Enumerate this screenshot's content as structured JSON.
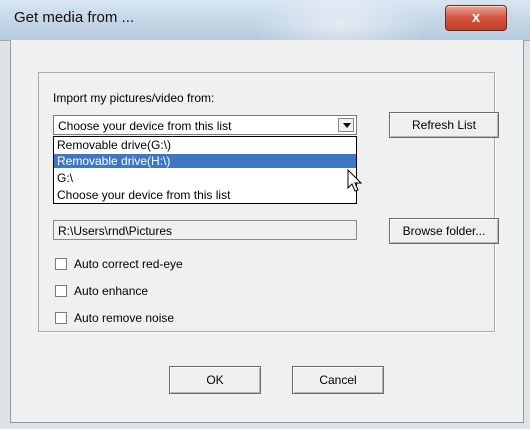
{
  "window": {
    "title": "Get media from ...",
    "close_glyph": "x"
  },
  "group": {
    "label": "Import my pictures/video from:"
  },
  "device_combo": {
    "selected": "Choose your device from this list",
    "options": [
      "Removable drive(G:\\)",
      "Removable drive(H:\\)",
      "G:\\",
      "Choose your device from this list"
    ],
    "highlighted_index": 1
  },
  "buttons": {
    "refresh": "Refresh List",
    "browse": "Browse folder...",
    "ok": "OK",
    "cancel": "Cancel"
  },
  "folder_path": {
    "value": "R:\\Users\\rnd\\Pictures"
  },
  "options": {
    "red_eye": "Auto correct red-eye",
    "enhance": "Auto enhance",
    "noise": "Auto remove noise"
  },
  "colors": {
    "selection": "#3f77c4",
    "close_button": "#d4553d"
  }
}
